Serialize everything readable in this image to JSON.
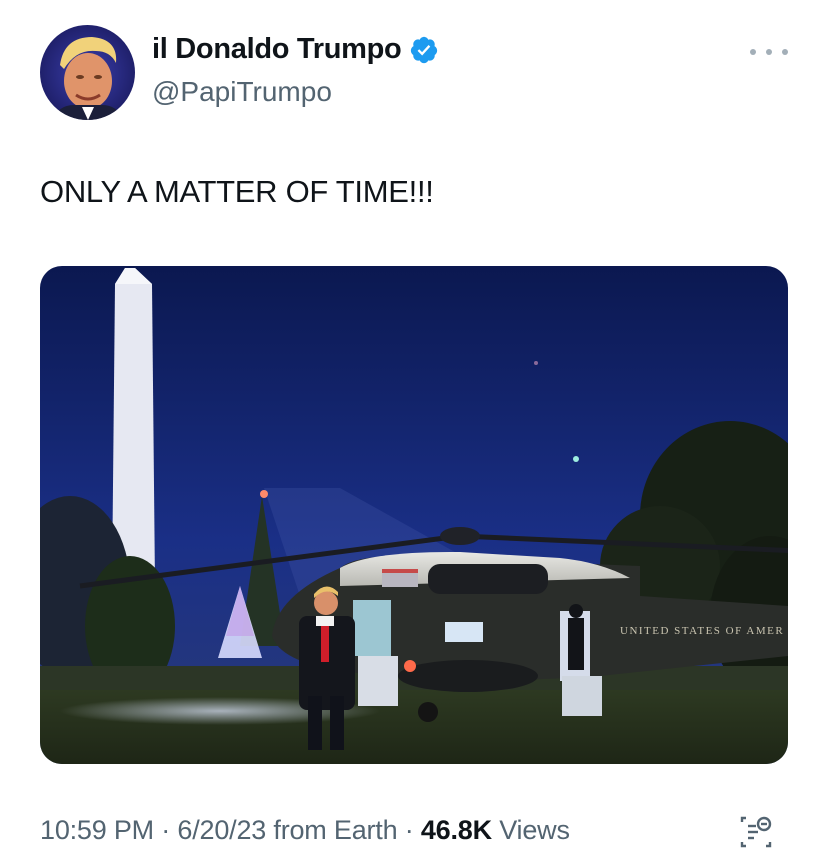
{
  "author": {
    "display_name": "il Donaldo Trumpo",
    "handle": "@PapiTrumpo",
    "verified": true,
    "avatar_icon": "profile-photo",
    "badge_color": "#1d9bf0"
  },
  "menu": {
    "icon": "more-options-icon"
  },
  "tweet": {
    "text": "ONLY A MATTER OF TIME!!!",
    "media": {
      "type": "photo",
      "helicopter_lettering": "UNITED STATES OF AMER"
    }
  },
  "footer": {
    "time": "10:59 PM",
    "separator": "·",
    "date": "6/20/23",
    "source": "from Earth",
    "views_count": "46.8K",
    "views_label": "Views",
    "analytics_icon": "analytics-icon"
  }
}
